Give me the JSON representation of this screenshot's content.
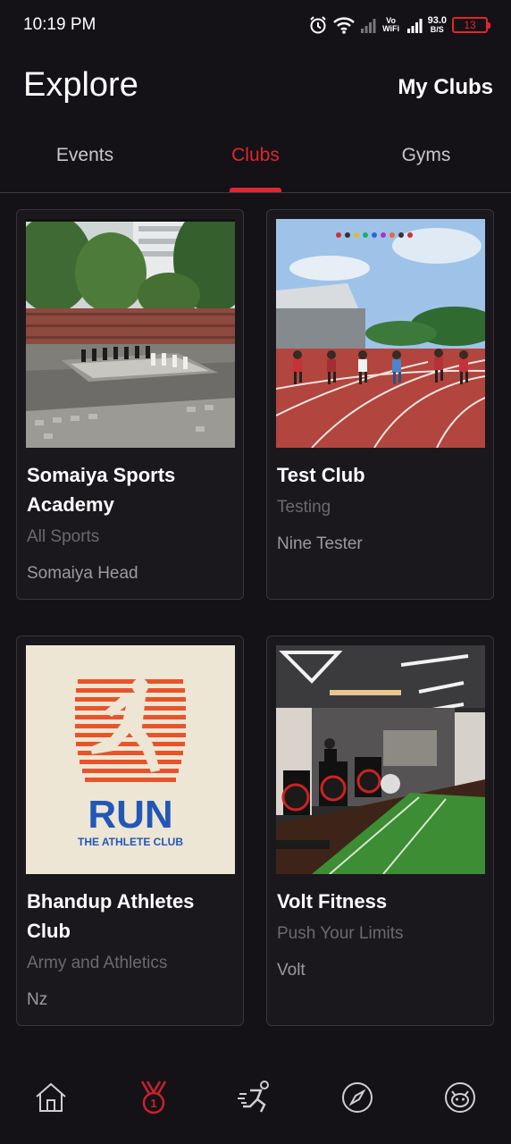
{
  "status_bar": {
    "time": "10:19 PM",
    "network": "Vo WiFi",
    "speed_value": "93.0",
    "speed_unit": "B/S",
    "battery_level": "13",
    "battery_color": "#e0262b",
    "icons": [
      "alarm-icon",
      "wifi-icon",
      "signal-icon",
      "vowifi-icon",
      "signal-icon-2",
      "battery-icon"
    ]
  },
  "header": {
    "title": "Explore",
    "my_clubs_label": "My Clubs"
  },
  "tabs": [
    {
      "label": "Events",
      "active": false
    },
    {
      "label": "Clubs",
      "active": true
    },
    {
      "label": "Gyms",
      "active": false
    }
  ],
  "accent_color": "#e2262d",
  "clubs": [
    {
      "name": "Somaiya Sports Academy",
      "category": "All Sports",
      "owner": "Somaiya Head",
      "image": "chess-courtyard-photo"
    },
    {
      "name": "Test Club",
      "category": "Testing",
      "owner": "Nine Tester",
      "image": "running-track-photo"
    },
    {
      "name": "Bhandup Athletes Club",
      "category": "Army and Athletics",
      "owner": "Nz",
      "image": "run-athlete-club-logo",
      "logo_text": "RUN",
      "logo_subtext": "THE ATHLETE CLUB"
    },
    {
      "name": "Volt Fitness",
      "category": "Push Your Limits",
      "owner": "Volt",
      "image": "gym-interior-photo"
    }
  ],
  "bottom_nav": [
    {
      "icon": "home-icon",
      "active": false
    },
    {
      "icon": "medal-icon",
      "active": true,
      "badge": "1"
    },
    {
      "icon": "runner-icon",
      "active": false
    },
    {
      "icon": "compass-icon",
      "active": false
    },
    {
      "icon": "profile-avatar-icon",
      "active": false
    }
  ]
}
